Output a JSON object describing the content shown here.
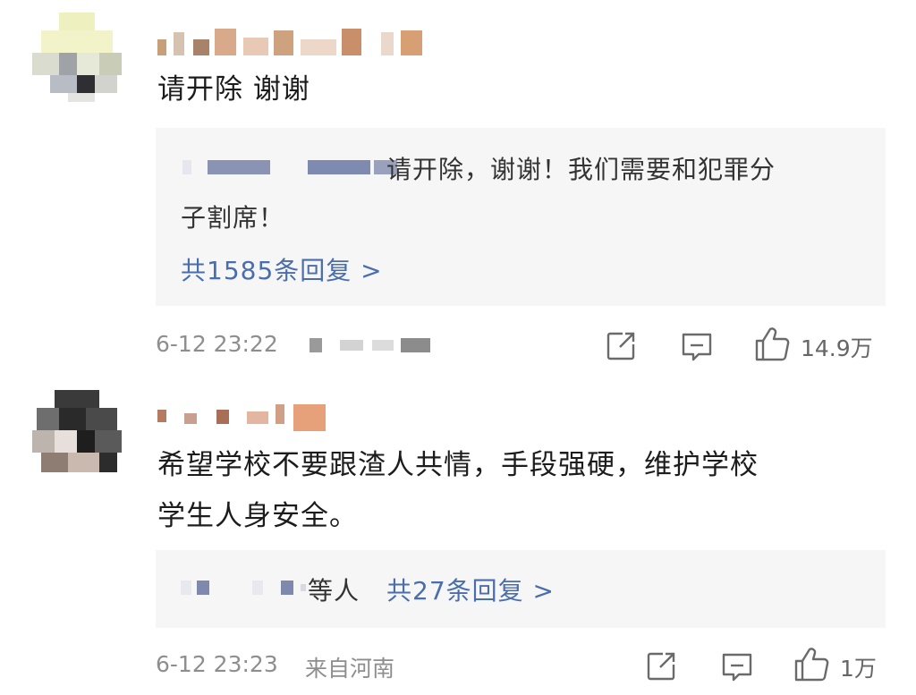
{
  "comments": [
    {
      "text": "请开除 谢谢",
      "reply_snippet_line1": "请开除，谢谢！我们需要和犯罪分",
      "reply_snippet_line2": "子割席！",
      "reply_count_link": "共1585条回复 >",
      "timestamp": "6-12 23:22",
      "location": "",
      "likes": "14.9万",
      "icons": [
        "share-icon",
        "comment-icon",
        "like-icon"
      ]
    },
    {
      "text_line1": "希望学校不要跟渣人共情，手段强硬，维护学校",
      "text_line2": "学生人身安全。",
      "reply_prefix": "等人",
      "reply_count_link": "共27条回复 >",
      "timestamp": "6-12 23:23",
      "location": "来自河南",
      "likes": "1万",
      "icons": [
        "share-icon",
        "comment-icon",
        "like-icon"
      ]
    }
  ],
  "colors": {
    "link": "#4a6dae",
    "meta": "#8e8e8e",
    "reply_bg": "#f6f6f6"
  }
}
